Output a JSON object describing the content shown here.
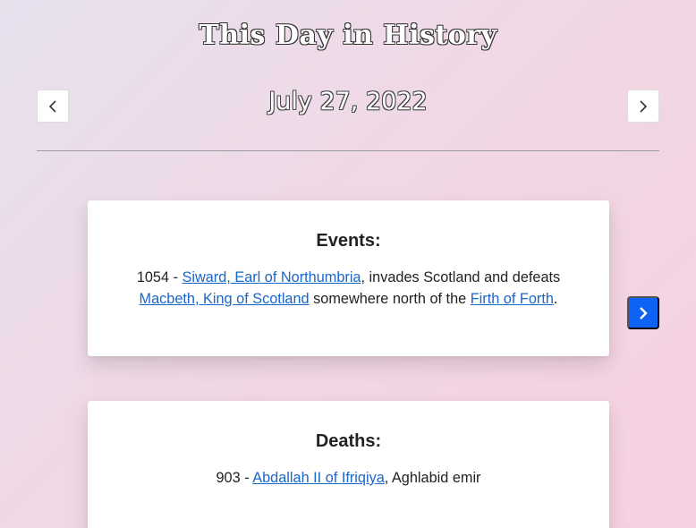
{
  "header": {
    "title": "This Day in History",
    "date": "July 27, 2022"
  },
  "icons": {
    "prev": "chevron-left-icon",
    "next": "chevron-right-icon",
    "carousel_next": "chevron-right-icon"
  },
  "colors": {
    "link": "#1a66c9",
    "primary_button": "#0d63f3"
  },
  "events": {
    "heading": "Events:",
    "year": "1054",
    "sep": " - ",
    "link1": "Siward, Earl of Northumbria",
    "text1": ", invades Scotland and defeats ",
    "link2": "Macbeth, King of Scotland",
    "text2": " somewhere north of the ",
    "link3": "Firth of Forth",
    "text3": "."
  },
  "deaths": {
    "heading": "Deaths:",
    "year": "903",
    "sep": " - ",
    "link1": "Abdallah II of Ifriqiya",
    "text1": ", Aghlabid emir"
  }
}
